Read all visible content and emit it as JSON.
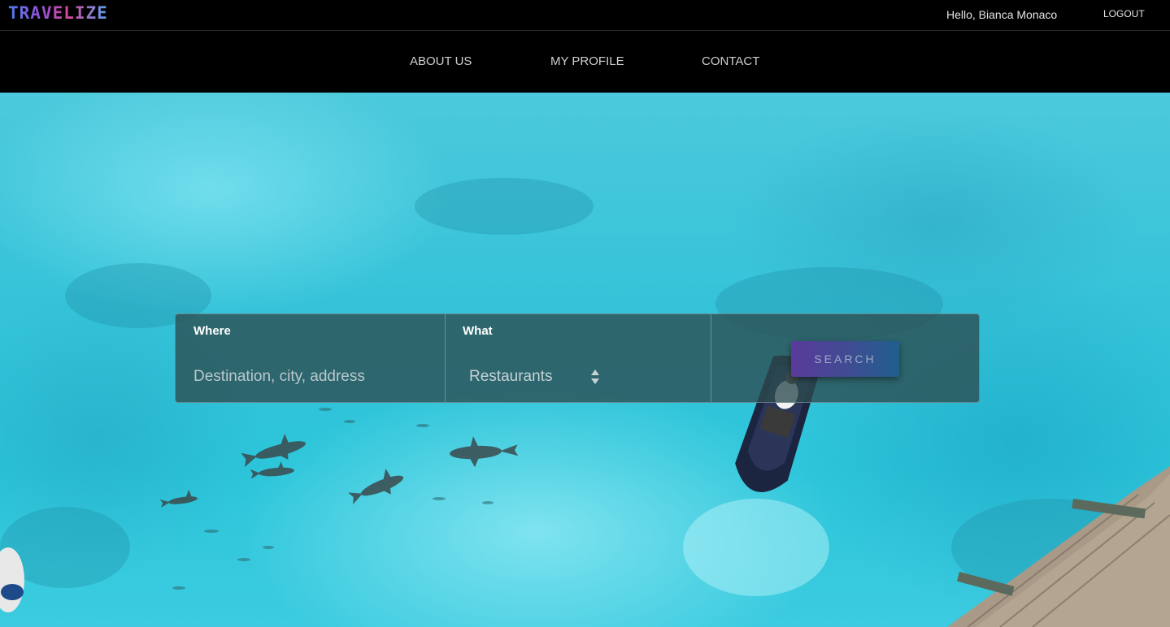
{
  "header": {
    "logo_text": "TRAVELIZE",
    "greeting": "Hello, Bianca Monaco",
    "logout_label": "LOGOUT"
  },
  "nav": {
    "about_label": "ABOUT US",
    "profile_label": "MY PROFILE",
    "contact_label": "CONTACT"
  },
  "search": {
    "where_label": "Where",
    "where_placeholder": "Destination, city, address",
    "where_value": "",
    "what_label": "What",
    "what_selected": "Restaurants",
    "button_label": "SEARCH"
  },
  "colors": {
    "page_background": "#000000",
    "hero_water": "#35c3d9",
    "button_gradient_start": "#5a3a9a",
    "button_gradient_end": "#1f5f8e"
  }
}
